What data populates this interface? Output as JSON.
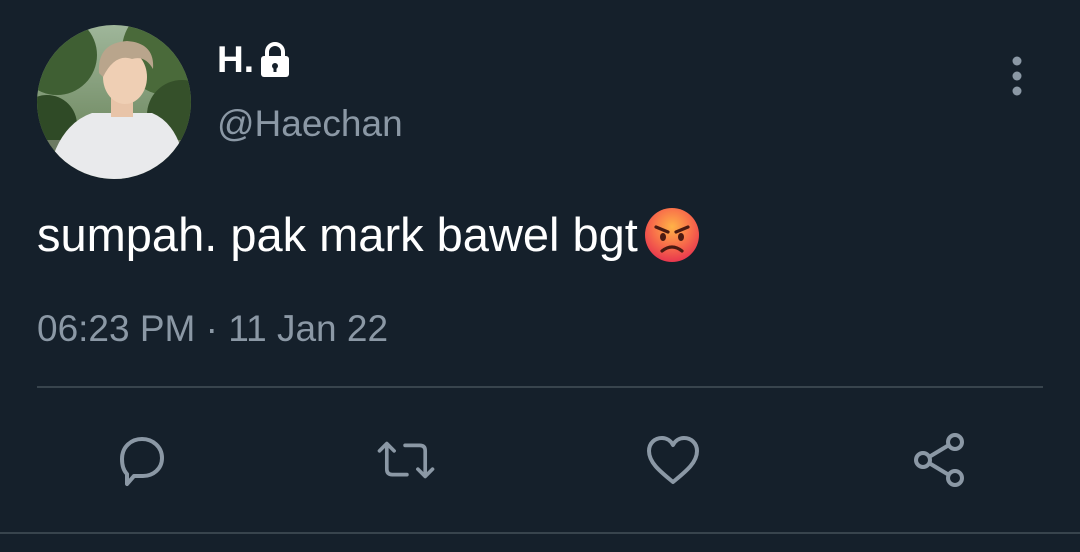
{
  "user": {
    "display_name": "H.",
    "handle": "@Haechan",
    "protected_icon": "lock-icon",
    "avatar": "profile-photo"
  },
  "tweet": {
    "text": "sumpah. pak mark bawel bgt",
    "emoji": "angry-face-icon",
    "time": "06:23 PM",
    "separator": "·",
    "date": "11 Jan 22"
  },
  "actions": [
    {
      "icon": "reply-icon"
    },
    {
      "icon": "retweet-icon"
    },
    {
      "icon": "like-icon"
    },
    {
      "icon": "share-icon"
    }
  ],
  "colors": {
    "background": "#15202b",
    "text_primary": "#ffffff",
    "text_secondary": "#8b98a5",
    "divider": "#38444d",
    "icon": "#8b98a5"
  }
}
